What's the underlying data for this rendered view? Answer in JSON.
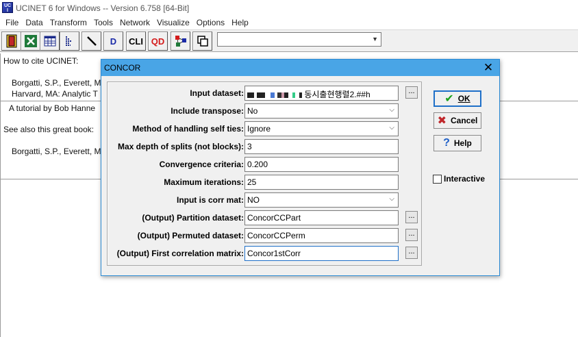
{
  "window": {
    "title": "UCINET 6 for Windows -- Version 6.758 [64-Bit]",
    "icon_name": "ucinet-app-icon"
  },
  "menu": [
    {
      "label": "File"
    },
    {
      "label": "Data"
    },
    {
      "label": "Transform"
    },
    {
      "label": "Tools"
    },
    {
      "label": "Network"
    },
    {
      "label": "Visualize"
    },
    {
      "label": "Options"
    },
    {
      "label": "Help"
    }
  ],
  "toolbar": {
    "buttons": [
      {
        "icon": "spreadsheet-editor-icon"
      },
      {
        "icon": "excel-icon"
      },
      {
        "icon": "matrix-editor-icon"
      },
      {
        "icon": "text-editor-icon"
      },
      {
        "icon": "draw-line-icon"
      },
      {
        "icon": "d-display-icon",
        "label": "D"
      },
      {
        "icon": "cli-icon",
        "label": "CLI"
      },
      {
        "icon": "qd-icon",
        "label": "QD"
      },
      {
        "icon": "netdraw-icon"
      },
      {
        "icon": "copy-windows-icon"
      }
    ],
    "combo_value": ""
  },
  "background": {
    "cite_heading": "How to cite UCINET:",
    "cite_line1": "Borgatti, S.P., Everett, M",
    "cite_line2": "Harvard, MA: Analytic T",
    "tutorial": "A tutorial by Bob Hanne",
    "see_also": "See also this great book:",
    "book_line": "Borgatti, S.P., Everett, M"
  },
  "dialog": {
    "title": "CONCOR",
    "close_glyph": "✕",
    "fields": [
      {
        "label": "Input dataset:",
        "value": "동시출현행렬2.##h",
        "type": "text",
        "browse": true
      },
      {
        "label": "Include transpose:",
        "value": "No",
        "type": "select"
      },
      {
        "label": "Method of handling self ties:",
        "value": "Ignore",
        "type": "select"
      },
      {
        "label": "Max depth of splits (not blocks):",
        "value": "3",
        "type": "text"
      },
      {
        "label": "Convergence criteria:",
        "value": "0.200",
        "type": "text"
      },
      {
        "label": "Maximum iterations:",
        "value": "25",
        "type": "text"
      },
      {
        "label": "Input is corr mat:",
        "value": "NO",
        "type": "select"
      },
      {
        "label": "(Output) Partition dataset:",
        "value": "ConcorCCPart",
        "type": "text",
        "browse": true
      },
      {
        "label": "(Output) Permuted dataset:",
        "value": "ConcorCCPerm",
        "type": "text",
        "browse": true
      },
      {
        "label": "(Output) First correlation matrix:",
        "value": "Concor1stCorr",
        "type": "text",
        "browse": true,
        "focused": true
      }
    ],
    "browse_label": "...",
    "buttons": {
      "ok": "OK",
      "cancel": "Cancel",
      "help": "Help"
    },
    "interactive": {
      "label": "Interactive",
      "checked": false
    },
    "colors": {
      "title_bar": "#49a5e6",
      "ok_check": "#1aa01a",
      "cancel_x": "#c0262a",
      "help_q": "#1e5fc8"
    }
  }
}
